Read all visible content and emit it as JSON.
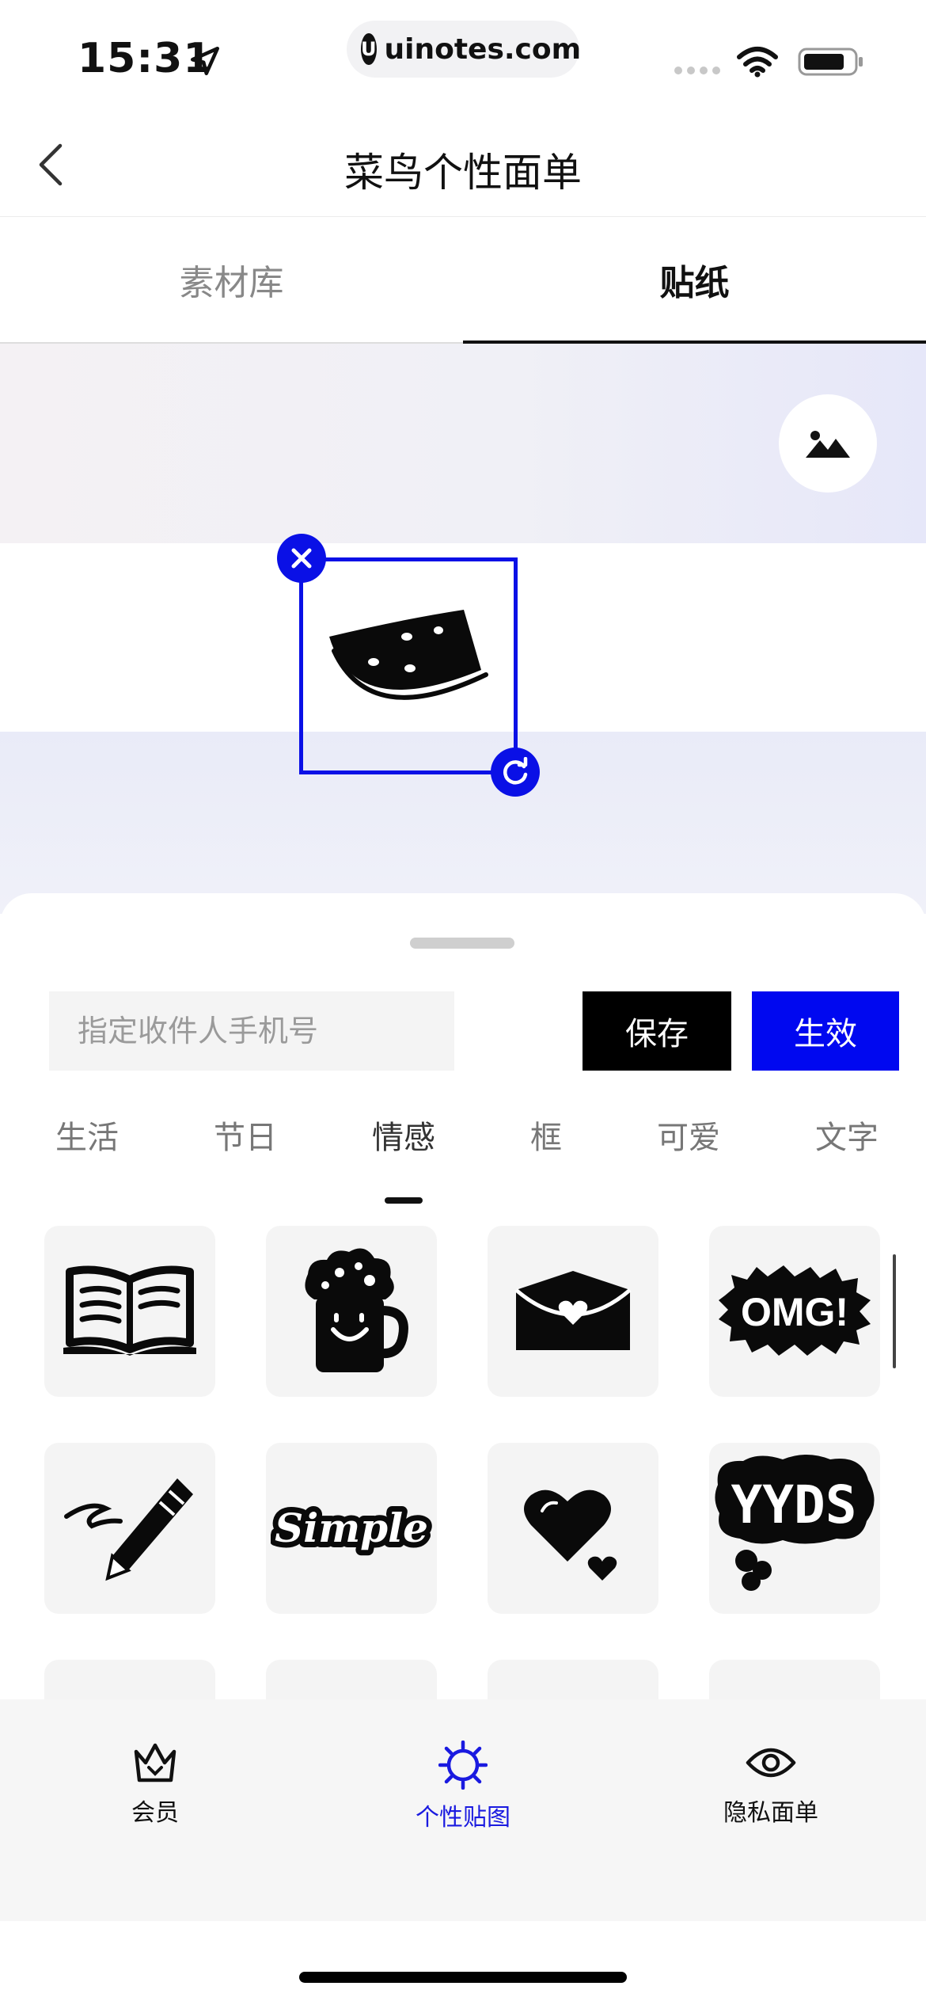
{
  "status": {
    "time": "15:31",
    "url": "uinotes.com",
    "url_logo": "U"
  },
  "nav": {
    "back_icon": "chevron-left-icon",
    "title": "菜鸟个性面单"
  },
  "tabs": [
    {
      "label": "素材库",
      "active": false
    },
    {
      "label": "贴纸",
      "active": true
    }
  ],
  "canvas": {
    "image_button_icon": "image-icon",
    "selected_sticker": "watermelon",
    "close_icon": "close-icon",
    "rotate_icon": "rotate-icon"
  },
  "sheet": {
    "phone_placeholder": "指定收件人手机号",
    "phone_value": "",
    "save_label": "保存",
    "apply_label": "生效",
    "categories": [
      "生活",
      "节日",
      "情感",
      "框",
      "可爱",
      "文字"
    ],
    "active_category": "情感",
    "stickers": [
      "open-book",
      "beer-mug",
      "heart-envelope",
      "omg-burst",
      "pencil-scribble",
      "simple-text",
      "hearts",
      "yyds-text"
    ],
    "sticker_texts": {
      "omg": "OMG!",
      "simple": "Simple",
      "yyds": "YYDS"
    }
  },
  "tabbar": [
    {
      "label": "会员",
      "icon": "crown-icon",
      "active": false
    },
    {
      "label": "个性贴图",
      "icon": "sun-icon",
      "active": true
    },
    {
      "label": "隐私面单",
      "icon": "eye-icon",
      "active": false
    }
  ],
  "colors": {
    "accent_blue": "#0008f0",
    "selection_blue": "#0a10e6",
    "tabbar_active": "#1a1ae0"
  }
}
